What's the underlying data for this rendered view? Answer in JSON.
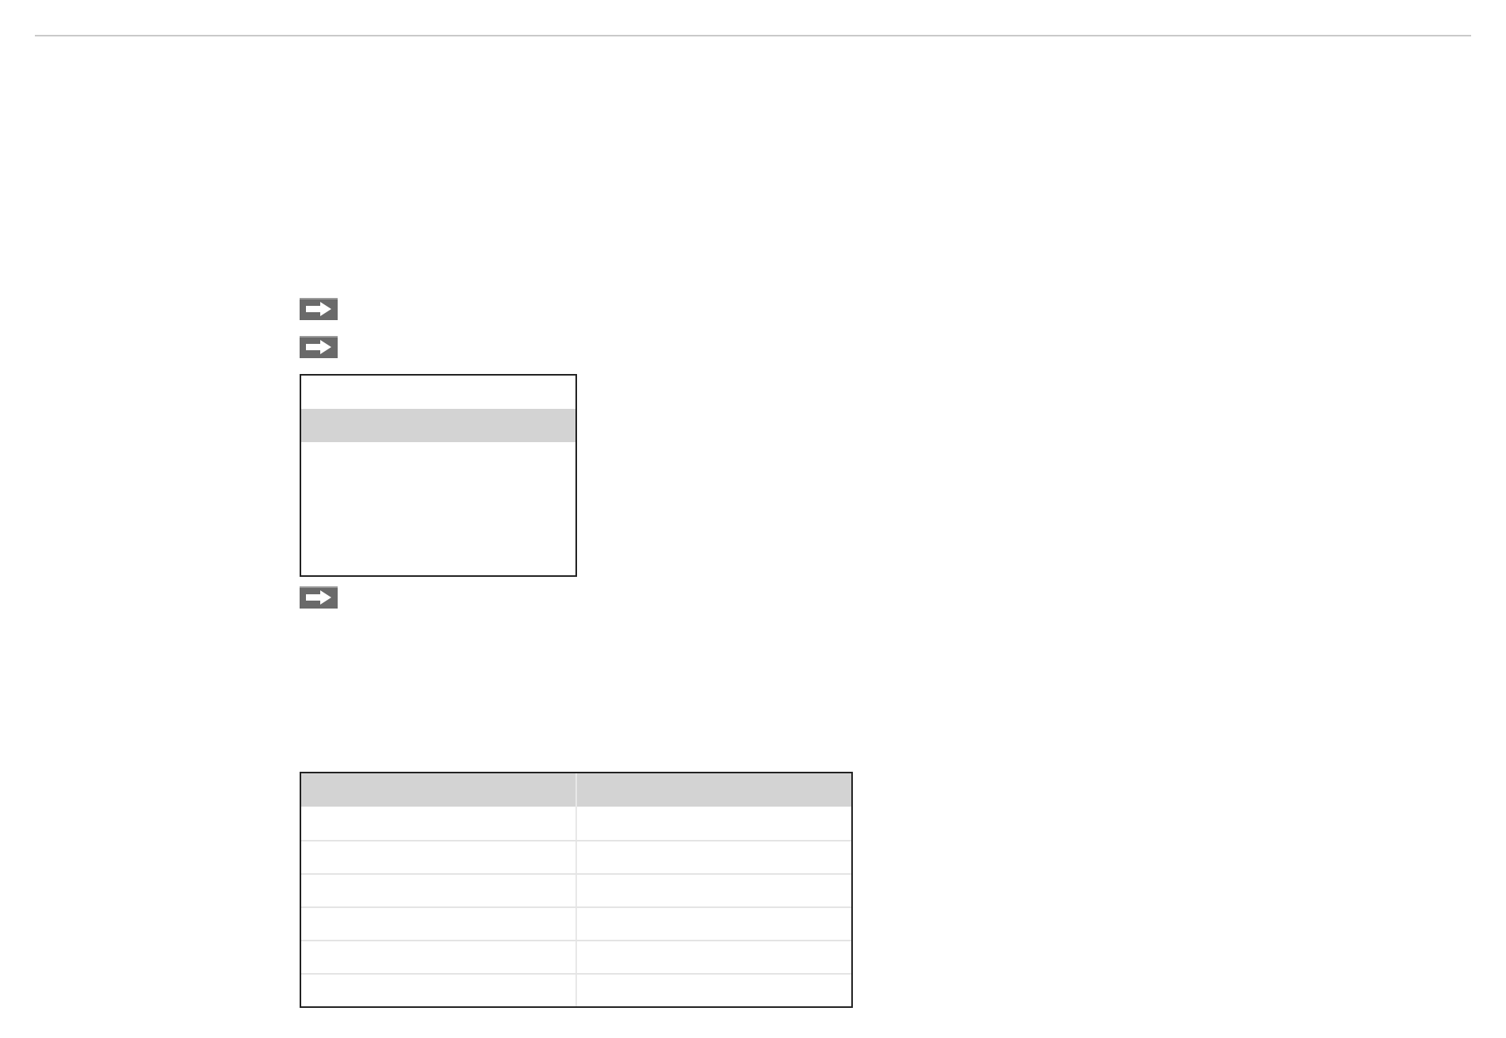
{
  "blocks": [
    {
      "kind": "step"
    },
    {
      "kind": "step"
    },
    {
      "kind": "menu",
      "items": [
        {
          "selected": false
        },
        {
          "selected": true
        },
        {
          "selected": false
        },
        {
          "selected": false
        },
        {
          "selected": false
        },
        {
          "selected": false
        }
      ]
    },
    {
      "kind": "step"
    },
    {
      "kind": "table",
      "rows": [
        {
          "kind": "header"
        },
        {
          "kind": "body"
        },
        {
          "kind": "body"
        },
        {
          "kind": "body"
        },
        {
          "kind": "body"
        },
        {
          "kind": "body"
        },
        {
          "kind": "body"
        }
      ]
    }
  ]
}
